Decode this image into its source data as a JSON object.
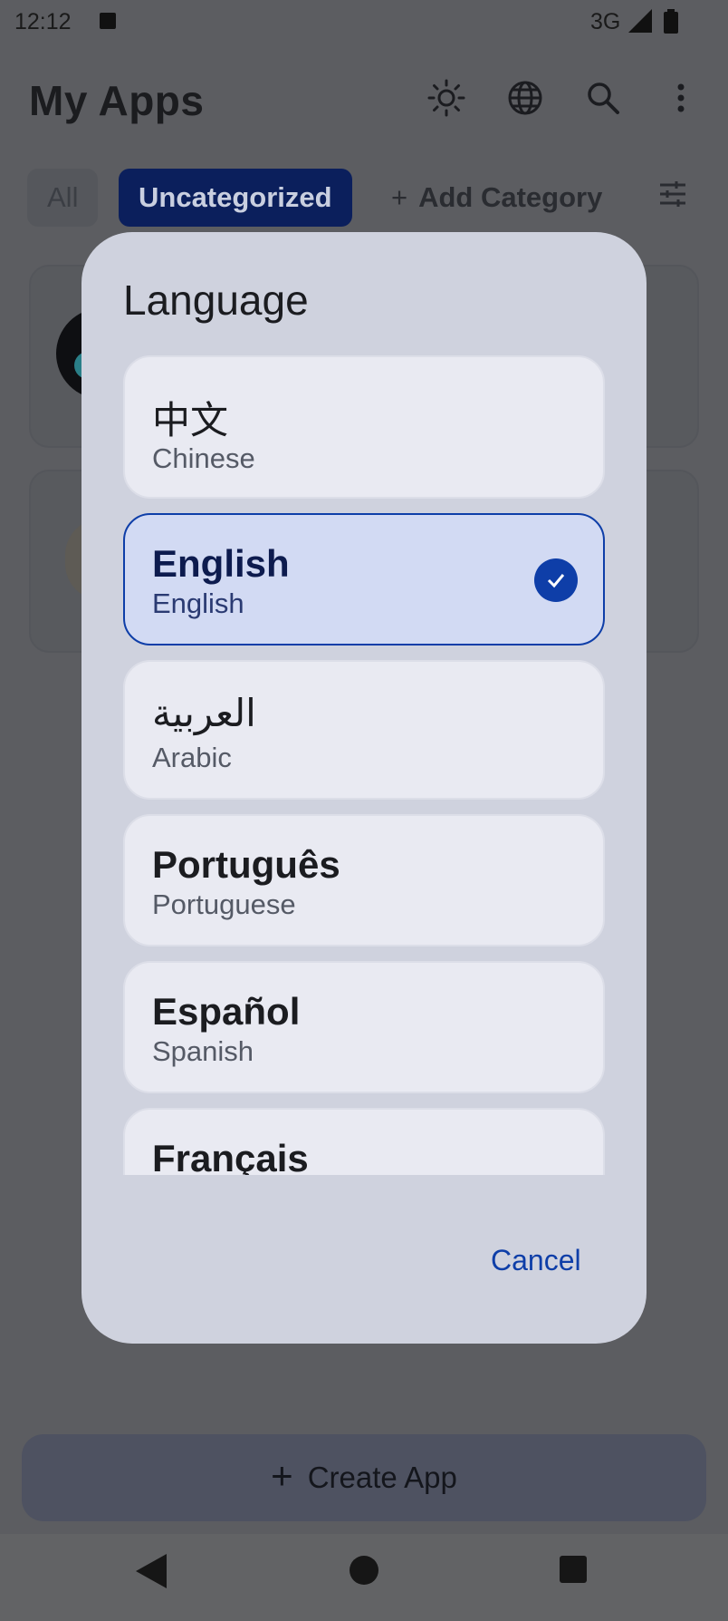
{
  "status": {
    "time": "12:12",
    "network": "3G"
  },
  "header": {
    "title": "My Apps"
  },
  "icons": {
    "theme": "brightness-icon",
    "language": "globe-icon",
    "search": "search-icon",
    "more": "more-vert-icon",
    "filter": "tune-icon"
  },
  "chips": {
    "all": "All",
    "uncategorized": "Uncategorized",
    "add_category": "Add Category"
  },
  "dialog": {
    "title": "Language",
    "options": [
      {
        "native": "中文",
        "english": "Chinese",
        "selected": false
      },
      {
        "native": "English",
        "english": "English",
        "selected": true
      },
      {
        "native": "العربية",
        "english": "Arabic",
        "selected": false
      },
      {
        "native": "Português",
        "english": "Portuguese",
        "selected": false
      },
      {
        "native": "Español",
        "english": "Spanish",
        "selected": false
      },
      {
        "native": "Français",
        "english": "",
        "selected": false
      }
    ],
    "cancel": "Cancel"
  },
  "footer": {
    "create_app": "Create App"
  },
  "colors": {
    "accent": "#0e3ea8",
    "dialog_bg": "#cfd2de",
    "selected_bg": "#d2daf3"
  }
}
